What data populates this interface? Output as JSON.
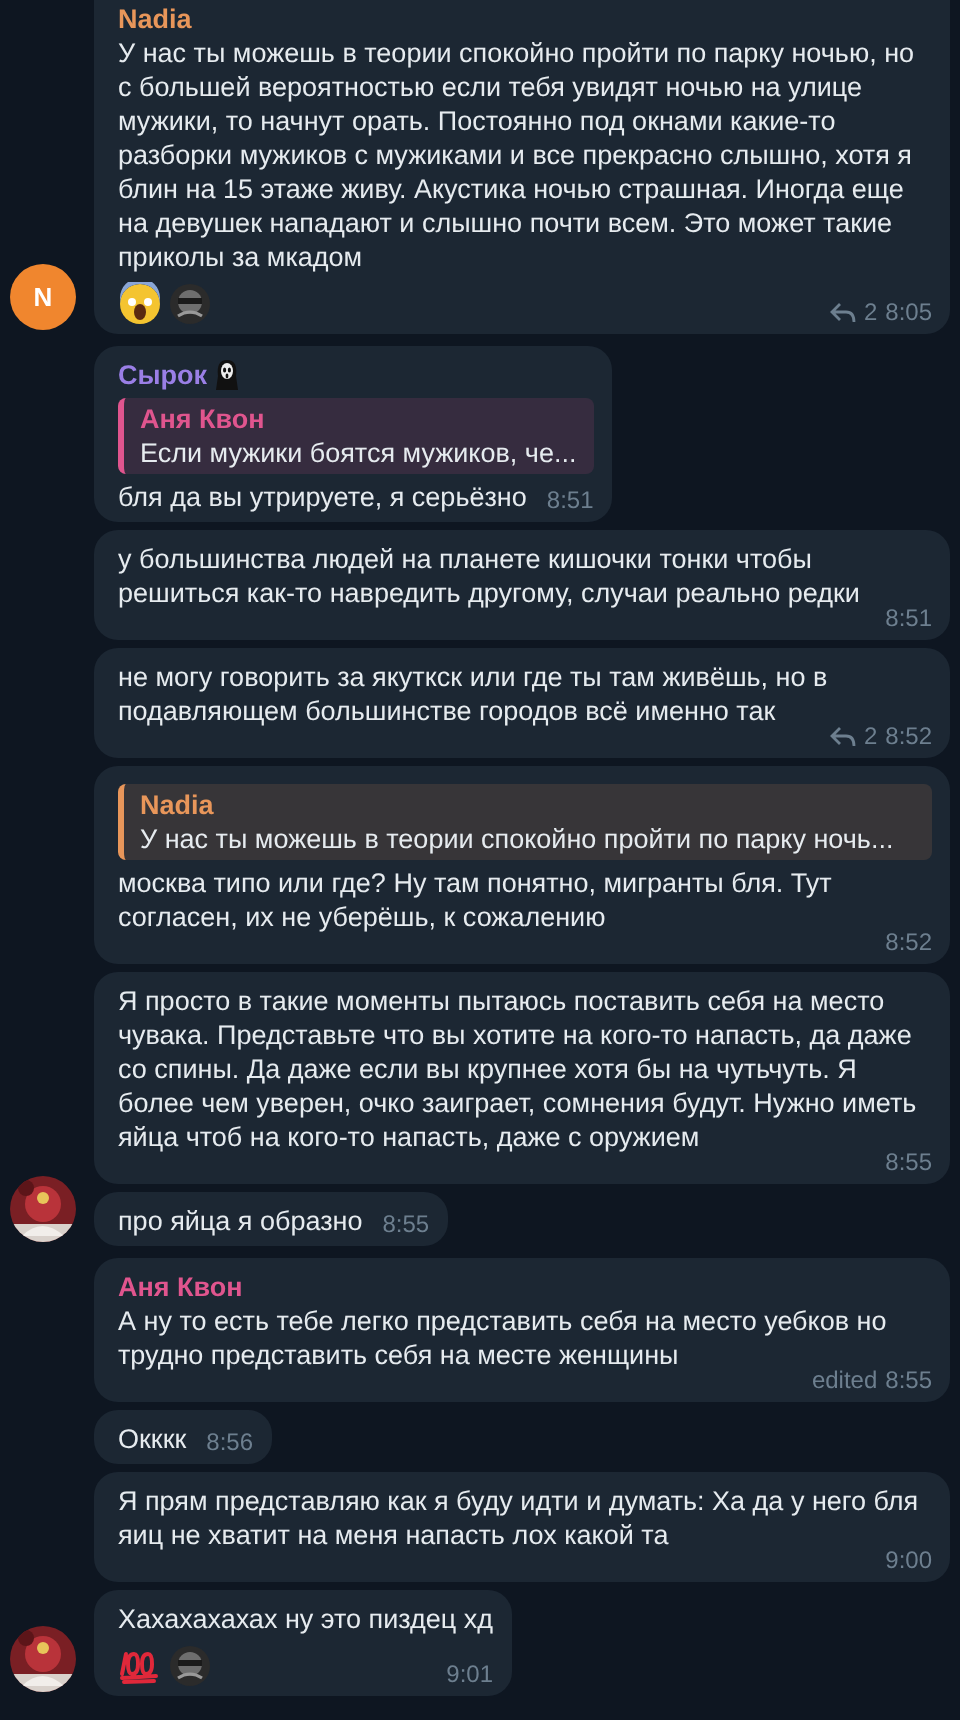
{
  "groups": [
    {
      "avatar": {
        "kind": "letter",
        "letter": "N"
      },
      "messages": [
        {
          "sender": {
            "name": "Nadia",
            "color": "#e8965a"
          },
          "text": "У нас ты можешь в теории спокойно пройти по парку ночью, но с большей вероятностью если тебя увидят ночью на улице мужики, то начнут орать. Постоянно под окнами какие-то разборки мужиков с мужиками и все прекрасно слышно, хотя я блин на 15 этаже живу. Акустика ночью страшная. Иногда еще на девушек нападают и слышно почти всем. Это может такие приколы за мкадом",
          "reactions": [
            {
              "kind": "scream"
            },
            {
              "kind": "sticker"
            }
          ],
          "replies": "2",
          "time": "8:05"
        }
      ]
    },
    {
      "messages": [
        {
          "sender": {
            "name": "Сырок",
            "color": "#9a7fe6",
            "has_badge": true
          },
          "reply": {
            "name": "Аня Квон",
            "color": "#e0558e",
            "text": "Если мужики боятся мужиков, че..."
          },
          "text": "бля да вы утрируете, я серьёзно",
          "time": "8:51"
        },
        {
          "text": "у большинства людей на планете кишочки тонки чтобы решиться как-то навредить другому, случаи реально редки",
          "time": "8:51"
        },
        {
          "text": "не могу говорить за якуткск или где ты там живёшь, но в подавляющем большинстве городов всё именно так",
          "replies": "2",
          "time": "8:52"
        },
        {
          "reply": {
            "name": "Nadia",
            "color": "#e8965a",
            "text": "У нас ты можешь в теории спокойно пройти по парку ночь..."
          },
          "text": "москва типо или где? Ну там понятно, мигранты бля. Тут согласен, их не уберёшь, к сожалению",
          "time": "8:52"
        },
        {
          "text": "Я просто в такие моменты пытаюсь поставить себя на место чувака. Представьте что вы хотите на кого-то напасть, да даже со спины. Да даже если вы крупнее хотя бы на чутьчуть. Я более чем уверен, очко заиграет, сомнения будут. Нужно иметь яйца чтоб на кого-то напасть, даже с оружием",
          "time": "8:55"
        },
        {
          "text": "про яйца я образно",
          "time": "8:55"
        }
      ]
    },
    {
      "messages": [
        {
          "sender": {
            "name": "Аня Квон",
            "color": "#e0558e"
          },
          "text": "А ну то есть тебе легко представить себя на место уебков но трудно представить себя на месте женщины",
          "edited": "edited",
          "time": "8:55"
        },
        {
          "text": "Окккк",
          "time": "8:56"
        },
        {
          "text": "Я прям представляю как я буду идти и думать: Ха да у него бля яиц не хватит на меня напасть лох какой та",
          "time": "9:00"
        },
        {
          "text": "Хахахахахах ну это пиздец хд",
          "reactions": [
            {
              "kind": "hundred"
            },
            {
              "kind": "sticker"
            }
          ],
          "time": "9:01"
        }
      ]
    }
  ]
}
